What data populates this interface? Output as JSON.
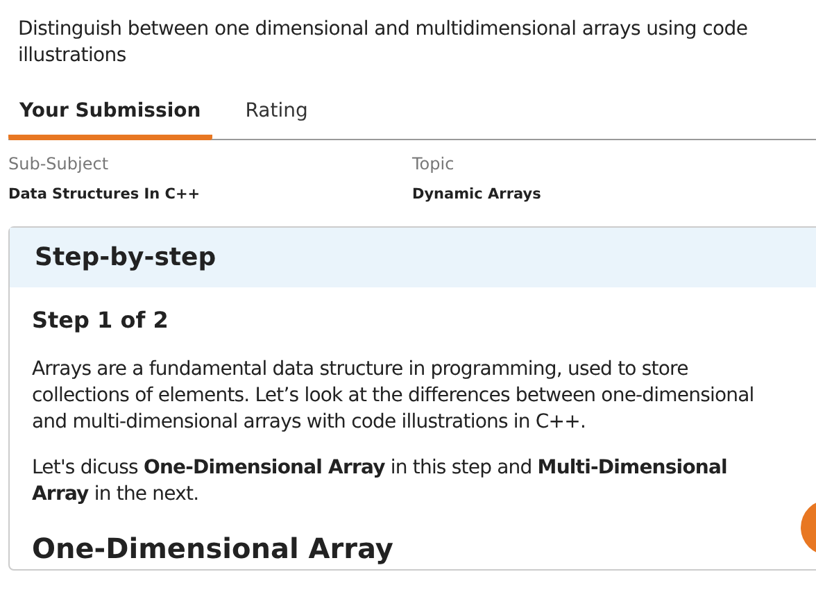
{
  "question": "Distinguish between one dimensional and multidimensional arrays using code illustrations",
  "tabs": [
    {
      "label": "Your Submission",
      "selected": true
    },
    {
      "label": "Rating",
      "selected": false
    }
  ],
  "meta": [
    {
      "label": "Sub-Subject",
      "value": "Data Structures In C++"
    },
    {
      "label": "Topic",
      "value": "Dynamic Arrays"
    }
  ],
  "card": {
    "title": "Step-by-step",
    "step": "Step 1 of 2",
    "paragraphs": [
      "Arrays are a fundamental data structure in programming, used to store collections of elements. Let’s look at the differences between one-dimensional and multi-dimensional arrays with code illustrations in C++.",
      "Let's dicuss **One-Dimensional Array** in this step and **Multi-Dimensional Array** in the next."
    ],
    "heading": "One-Dimensional Array"
  }
}
